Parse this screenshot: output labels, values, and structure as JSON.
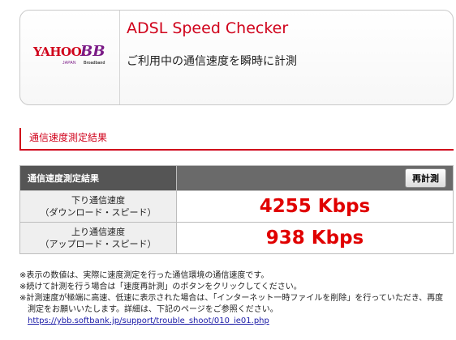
{
  "header": {
    "logo": {
      "yahoo": "YAHOO!",
      "bb": "BB",
      "japan": "JAPAN",
      "broadband": "Broadband"
    },
    "title": "ADSL Speed Checker",
    "subtitle": "ご利用中の通信速度を瞬時に計測"
  },
  "section": {
    "title": "通信速度測定結果"
  },
  "results": {
    "header_label": "通信速度測定結果",
    "retest_label": "再計測",
    "rows": [
      {
        "label_line1": "下り通信速度",
        "label_line2": "（ダウンロード・スピード）",
        "value": "4255 Kbps"
      },
      {
        "label_line1": "上り通信速度",
        "label_line2": "（アップロード・スピード）",
        "value": "938 Kbps"
      }
    ]
  },
  "notes": {
    "line1": "※表示の数値は、実際に速度測定を行った通信環境の通信速度です。",
    "line2": "※続けて計測を行う場合は「速度再計測」のボタンをクリックしてください。",
    "line3": "※計測速度が極端に高速、低速に表示された場合は、「インターネット一時ファイルを削除」を行っていただき、再度",
    "line4": "測定をお願いいたします。詳細は、下記のページをご参照ください。",
    "link": "https://ybb.softbank.jp/support/trouble_shoot/010_ie01.php"
  },
  "colors": {
    "accent": "#d0021b",
    "value_red": "#e00000",
    "header_gray": "#555555"
  }
}
